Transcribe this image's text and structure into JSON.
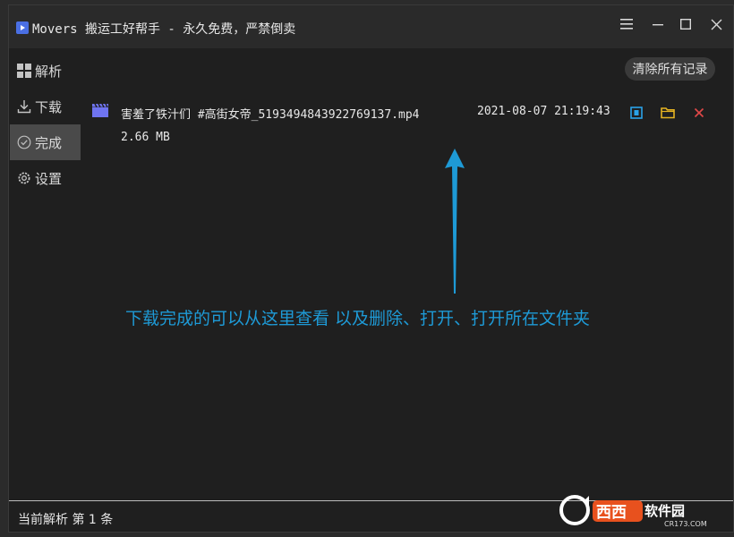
{
  "window": {
    "title": "Movers 搬运工好帮手 - 永久免费，严禁倒卖"
  },
  "window_controls": [
    "menu-icon",
    "minimize-icon",
    "maximize-icon",
    "close-icon"
  ],
  "sidebar": {
    "items": [
      {
        "label": "解析",
        "icon": "grid-icon",
        "active": false
      },
      {
        "label": "下载",
        "icon": "download-icon",
        "active": false
      },
      {
        "label": "完成",
        "icon": "check-circle-icon",
        "active": true
      },
      {
        "label": "设置",
        "icon": "gear-icon",
        "active": false
      }
    ]
  },
  "toolbar": {
    "clear_label": "清除所有记录"
  },
  "downloads": [
    {
      "filename": "害羞了铁汁们 #高街女帝_5193494843922769137.mp4",
      "date": "2021-08-07 21:19:43",
      "size": "2.66 MB",
      "actions": [
        "open-file-icon",
        "open-folder-icon",
        "delete-icon"
      ]
    }
  ],
  "annotation": {
    "text": "下载完成的可以从这里查看 以及删除、打开、打开所在文件夹"
  },
  "status": {
    "text": "当前解析 第 1 条"
  },
  "watermark": {
    "text": "西西软件园",
    "sub": "CR173.COM"
  },
  "colors": {
    "accent_blue": "#1e9ad6",
    "video_icon": "#6f74f0",
    "open_icon": "#2aa3e8",
    "folder_icon": "#e6b422",
    "delete_icon": "#e04848"
  }
}
